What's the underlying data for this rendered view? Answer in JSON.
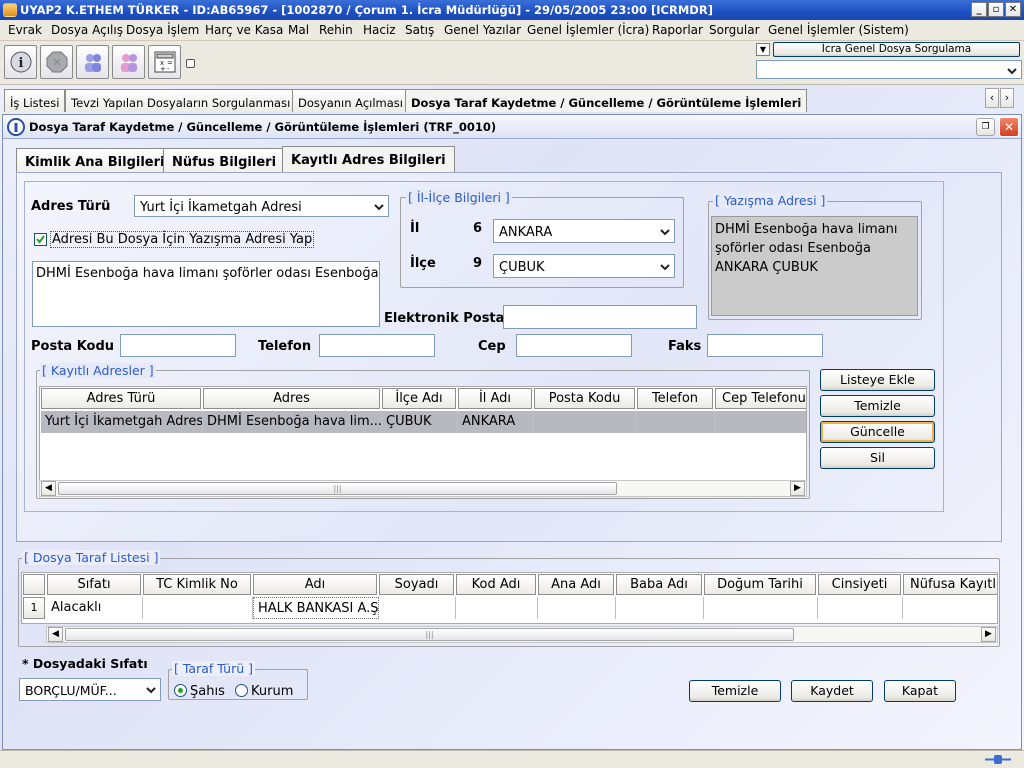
{
  "window": {
    "title": "UYAP2  K.ETHEM TÜRKER - ID:AB65967 - [1002870 / Çorum 1. İcra Müdürlüğü] - 29/05/2005 23:00 [ICRMDR]"
  },
  "menu": [
    "Evrak",
    "Dosya Açılış",
    "Dosya İşlem",
    "Harç ve Kasa",
    "Mal",
    "Rehin",
    "Haciz",
    "Satış",
    "Genel Yazılar",
    "Genel İşlemler (İcra)",
    "Raporlar",
    "Sorgular",
    "Genel İşlemler (Sistem)"
  ],
  "toolbar": {
    "icons": [
      "info-icon",
      "stop-icon",
      "users-icon",
      "group-icon",
      "calculator-icon"
    ],
    "query_label": "İcra Genel Dosya Sorgulama",
    "query_value": ""
  },
  "top_tabs": [
    "İş Listesi",
    "Tevzi Yapılan Dosyaların Sorgulanması",
    "Dosyanın Açılması",
    "Dosya Taraf Kaydetme / Güncelleme / Görüntüleme İşlemleri"
  ],
  "frame": {
    "title": "Dosya Taraf Kaydetme / Güncelleme / Görüntüleme İşlemleri (TRF_0010)"
  },
  "sub_tabs": [
    "Kimlik Ana Bilgileri",
    "Nüfus Bilgileri",
    "Kayıtlı Adres Bilgileri"
  ],
  "address": {
    "type_label": "Adres Türü",
    "type_value": "Yurt İçi İkametgah Adresi",
    "correspondence_checkbox_label": "Adresi Bu Dosya İçin Yazışma Adresi Yap",
    "correspondence_checked": true,
    "address_text": "DHMİ Esenboğa hava limanı şoförler odası Esenboğa",
    "il_ilce_legend": "[ İl-İlçe Bilgileri ]",
    "il_label": "İl",
    "il_code": "6",
    "il_value": "ANKARA",
    "ilce_label": "İlçe",
    "ilce_code": "9",
    "ilce_value": "ÇUBUK",
    "yazisma_legend": "[ Yazışma Adresi ]",
    "yazisma_lines": [
      "DHMİ Esenboğa hava limanı",
      "şoförler odası Esenboğa",
      "ANKARA ÇUBUK"
    ],
    "email_label": "Elektronik Posta",
    "email_value": "",
    "posta_label": "Posta Kodu",
    "posta_value": "",
    "telefon_label": "Telefon",
    "telefon_value": "",
    "cep_label": "Cep",
    "cep_value": "",
    "faks_label": "Faks",
    "faks_value": ""
  },
  "registered": {
    "legend": "[ Kayıtlı Adresler ]",
    "columns": [
      "Adres Türü",
      "Adres",
      "İlçe Adı",
      "İl Adı",
      "Posta Kodu",
      "Telefon",
      "Cep Telefonu"
    ],
    "rows": [
      [
        "Yurt İçi İkametgah Adresi",
        "DHMİ Esenboğa hava lim...",
        "ÇUBUK",
        "ANKARA",
        "",
        "",
        ""
      ]
    ]
  },
  "side_buttons": [
    "Listeye Ekle",
    "Temizle",
    "Güncelle",
    "Sil"
  ],
  "party_list": {
    "legend": "[ Dosya Taraf Listesi ]",
    "columns": [
      "Sıfatı",
      "TC Kimlik No",
      "Adı",
      "Soyadı",
      "Kod Adı",
      "Ana Adı",
      "Baba Adı",
      "Doğum Tarihi",
      "Cinsiyeti",
      "Nüfusa Kayıtlı Olduğu"
    ],
    "rows": [
      {
        "no": "1",
        "cells": [
          "Alacaklı",
          "",
          "HALK BANKASI A.Ş.",
          "",
          "",
          "",
          "",
          "",
          "",
          ""
        ]
      }
    ]
  },
  "bottom": {
    "sifat_label": "* Dosyadaki Sıfatı",
    "sifat_value": "BORÇLU/MÜF...",
    "taraf_legend": "[ Taraf Türü ]",
    "radio_sahis": "Şahıs",
    "radio_kurum": "Kurum",
    "selected": "Şahıs",
    "buttons": [
      "Temizle",
      "Kaydet",
      "Kapat"
    ]
  },
  "colors": {
    "title_bar": "#1d4fc0",
    "legend": "#2a5cc8",
    "selected_row": "#b8b8c0"
  }
}
